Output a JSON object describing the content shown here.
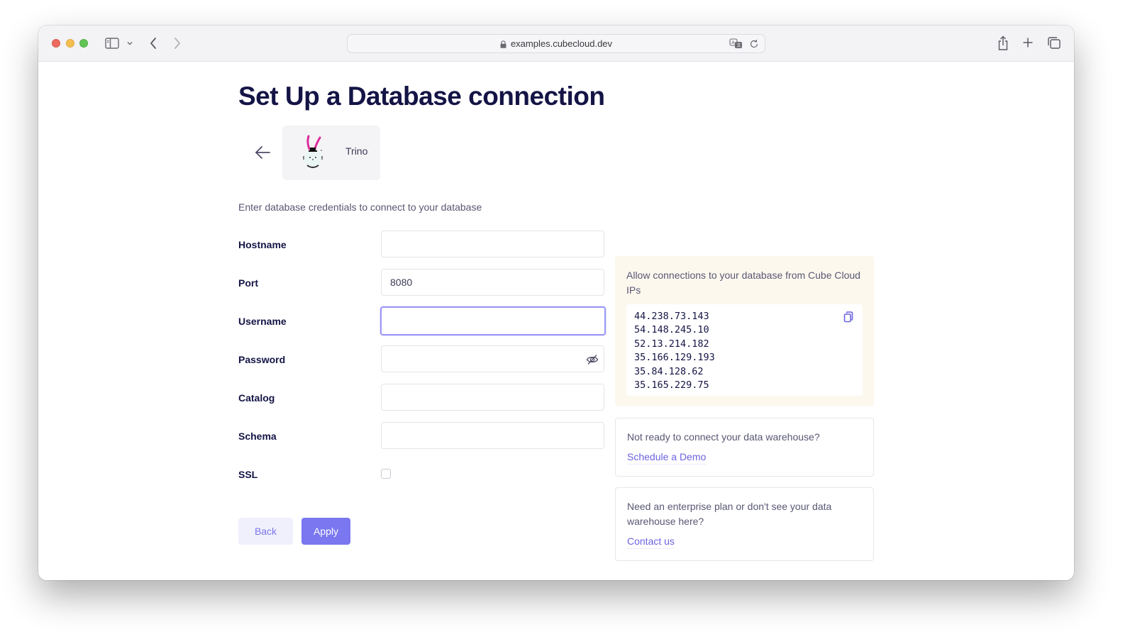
{
  "browser": {
    "url": "examples.cubecloud.dev",
    "icons": {
      "sidebar": "sidebar-toggle-icon",
      "sidebar_menu": "chevron-down-icon",
      "back": "chevron-left-icon",
      "forward": "chevron-right-icon",
      "lock": "lock-icon",
      "translate": "translate-icon",
      "reload": "reload-icon",
      "share": "share-icon",
      "new_tab": "plus-icon",
      "tab_overview": "tabs-overview-icon"
    }
  },
  "page": {
    "title": "Set Up a Database connection",
    "back_icon": "arrow-left-icon",
    "selected_database": {
      "name": "Trino",
      "logo": "trino-bunny-logo"
    },
    "subtitle": "Enter database credentials to connect to your database"
  },
  "form": {
    "fields": [
      {
        "label": "Hostname",
        "value": "",
        "type": "text"
      },
      {
        "label": "Port",
        "value": "8080",
        "type": "text"
      },
      {
        "label": "Username",
        "value": "",
        "type": "text",
        "focused": true
      },
      {
        "label": "Password",
        "value": "",
        "type": "password",
        "icon": "eye-slash-icon"
      },
      {
        "label": "Catalog",
        "value": "",
        "type": "text"
      },
      {
        "label": "Schema",
        "value": "",
        "type": "text"
      }
    ],
    "ssl": {
      "label": "SSL",
      "checked": false
    },
    "buttons": {
      "back": "Back",
      "apply": "Apply"
    }
  },
  "ip_panel": {
    "title": "Allow connections to your database from Cube Cloud IPs",
    "ips": [
      "44.238.73.143",
      "54.148.245.10",
      "52.13.214.182",
      "35.166.129.193",
      "35.84.128.62",
      "35.165.229.75"
    ],
    "copy_icon": "copy-icon"
  },
  "help_cards": [
    {
      "text": "Not ready to connect your data warehouse?",
      "link": "Schedule a Demo"
    },
    {
      "text": "Need an enterprise plan or don't see your data warehouse here?",
      "link": "Contact us"
    }
  ],
  "colors": {
    "title": "#141446",
    "accent": "#7a77f0",
    "link": "#6b63e0",
    "focus_ring": "#9b97f7",
    "ip_panel_bg": "#fdf8ee"
  }
}
